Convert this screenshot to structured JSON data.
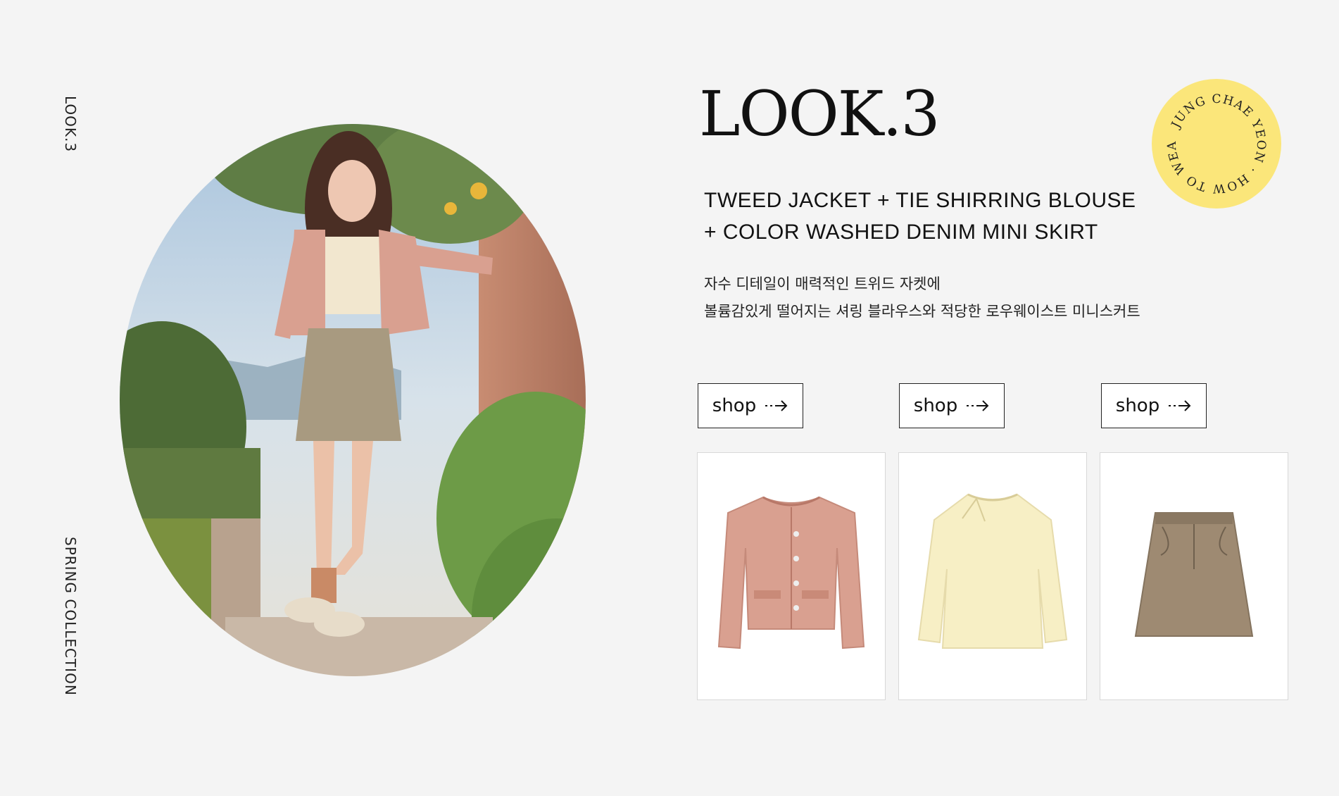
{
  "side_labels": {
    "top": "LOOK.3",
    "bottom": "SPRING COLLECTION"
  },
  "look": {
    "title": "LOOK.3",
    "headline_line1": "TWEED JACKET + TIE SHIRRING BLOUSE",
    "headline_line2": "+ COLOR WASHED DENIM MINI SKIRT",
    "desc_line1": "자수 디테일이 매력적인 트위드 자켓에",
    "desc_line2": "볼륨감있게 떨어지는 셔링 블라우스와 적당한 로우웨이스트 미니스커트"
  },
  "badge": {
    "text": "JUNG CHAE YEON · HOW TO WEAR ·",
    "color": "#fbe67a"
  },
  "products": [
    {
      "shop_label": "shop",
      "icon": "tweed-jacket",
      "color": "#d9a090"
    },
    {
      "shop_label": "shop",
      "icon": "shirring-blouse",
      "color": "#f7efc5"
    },
    {
      "shop_label": "shop",
      "icon": "denim-mini-skirt",
      "color": "#9e8a72"
    }
  ]
}
